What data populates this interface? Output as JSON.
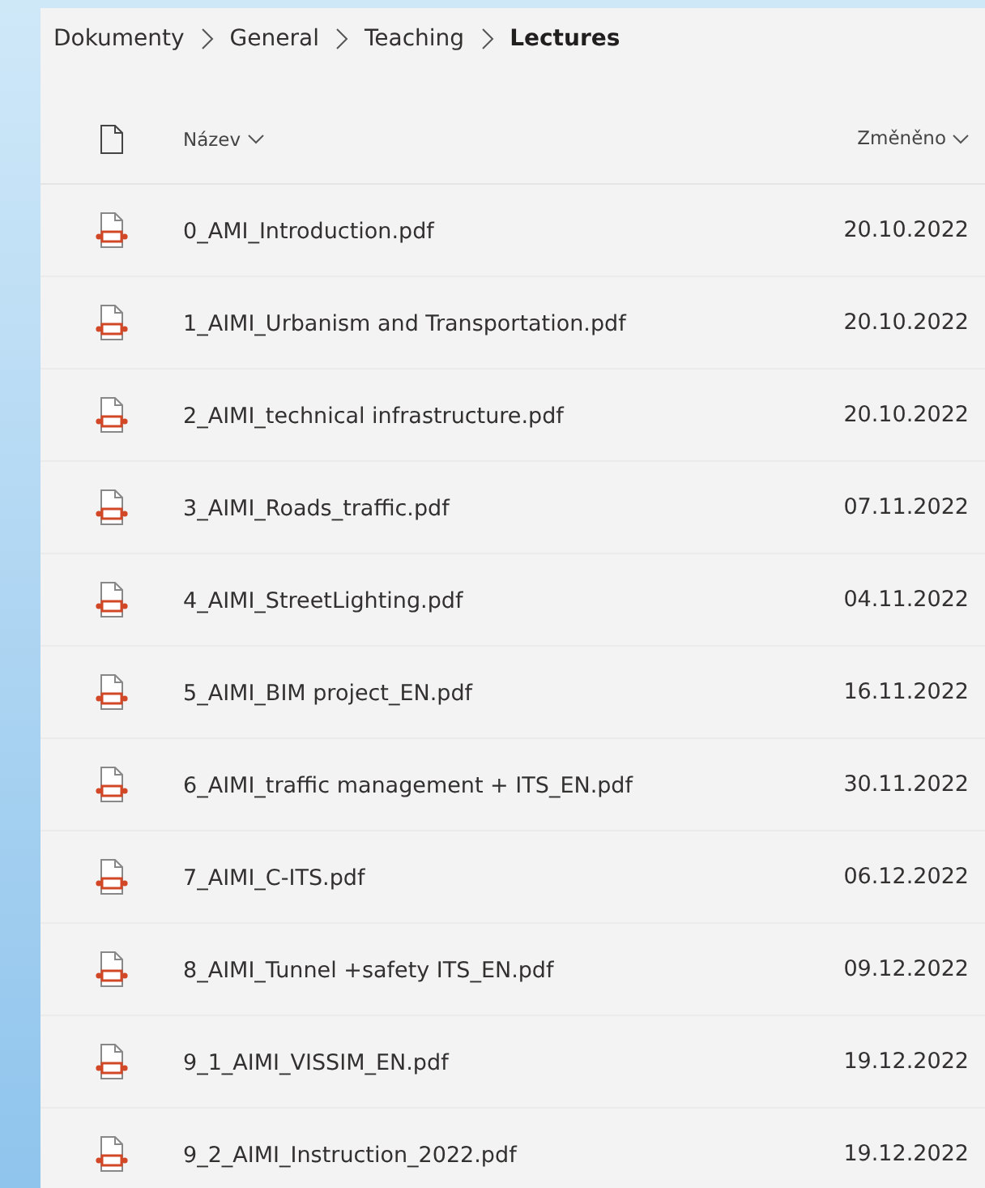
{
  "breadcrumb": [
    {
      "label": "Dokumenty",
      "current": false
    },
    {
      "label": "General",
      "current": false
    },
    {
      "label": "Teaching",
      "current": false
    },
    {
      "label": "Lectures",
      "current": true
    }
  ],
  "table": {
    "columns": [
      {
        "kind": "type"
      },
      {
        "kind": "name",
        "label": "Název"
      },
      {
        "kind": "modified",
        "label": "Změněno"
      }
    ],
    "rows": [
      {
        "name": "0_AMI_Introduction.pdf",
        "modified": "20.10.2022"
      },
      {
        "name": "1_AIMI_Urbanism and Transportation.pdf",
        "modified": "20.10.2022"
      },
      {
        "name": "2_AIMI_technical infrastructure.pdf",
        "modified": "20.10.2022"
      },
      {
        "name": "3_AIMI_Roads_traffic.pdf",
        "modified": "07.11.2022"
      },
      {
        "name": "4_AIMI_StreetLighting.pdf",
        "modified": "04.11.2022"
      },
      {
        "name": "5_AIMI_BIM project_EN.pdf",
        "modified": "16.11.2022"
      },
      {
        "name": "6_AIMI_traffic management + ITS_EN.pdf",
        "modified": "30.11.2022"
      },
      {
        "name": "7_AIMI_C-ITS.pdf",
        "modified": "06.12.2022"
      },
      {
        "name": "8_AIMI_Tunnel +safety ITS_EN.pdf",
        "modified": "09.12.2022"
      },
      {
        "name": "9_1_AIMI_VISSIM_EN.pdf",
        "modified": "19.12.2022"
      },
      {
        "name": "9_2_AIMI_Instruction_2022.pdf",
        "modified": "19.12.2022"
      }
    ]
  }
}
